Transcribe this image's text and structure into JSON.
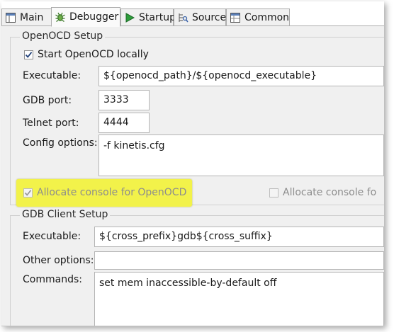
{
  "tabs": [
    {
      "label": "Main",
      "icon": "main-tab-icon"
    },
    {
      "label": "Debugger",
      "icon": "debugger-bug-icon"
    },
    {
      "label": "Startup",
      "icon": "startup-play-icon"
    },
    {
      "label": "Source",
      "icon": "source-lookup-icon"
    },
    {
      "label": "Common",
      "icon": "common-tab-icon"
    }
  ],
  "active_tab": "Debugger",
  "openocd": {
    "title": "OpenOCD Setup",
    "start_locally": {
      "label": "Start OpenOCD locally",
      "checked": true
    },
    "executable": {
      "label": "Executable:",
      "value": "${openocd_path}/${openocd_executable}"
    },
    "gdb_port": {
      "label": "GDB port:",
      "value": "3333"
    },
    "telnet_port": {
      "label": "Telnet port:",
      "value": "4444"
    },
    "config_options": {
      "label": "Config options:",
      "value": "-f kinetis.cfg"
    },
    "allocate_console": {
      "label": "Allocate console for OpenOCD",
      "checked": true,
      "enabled": false
    },
    "allocate_console_telnet": {
      "label": "Allocate console fo",
      "checked": false,
      "enabled": false
    }
  },
  "gdb_client": {
    "title": "GDB Client Setup",
    "executable": {
      "label": "Executable:",
      "value": "${cross_prefix}gdb${cross_suffix}"
    },
    "other_options": {
      "label": "Other options:",
      "value": ""
    },
    "commands": {
      "label": "Commands:",
      "value": "set mem inaccessible-by-default off"
    }
  },
  "colors": {
    "highlight": "#f2f24a",
    "panel_background": "#f0f0f0",
    "checkmark": "#1f3f78"
  }
}
